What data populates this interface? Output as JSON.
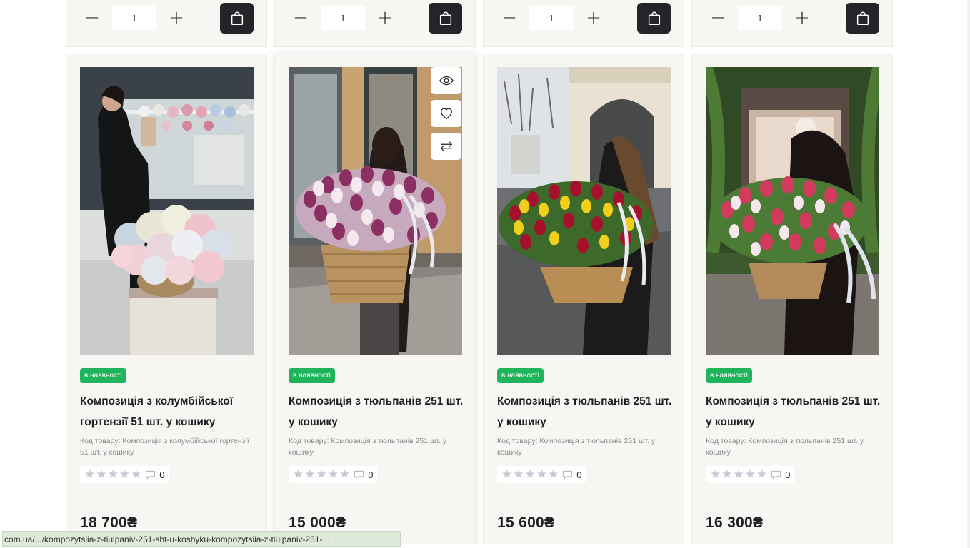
{
  "top_row": {
    "quantity": "1",
    "minus_label": "−",
    "plus_label": "+"
  },
  "products": [
    {
      "badge": "в наявності",
      "title": "Композиція з колумбійської гортензії 51 шт. у кошику",
      "sku": "Код товару: Композиція з колумбійської гортензії 51 шт. у кошику",
      "review_count": "0",
      "price": "18 700₴"
    },
    {
      "badge": "в наявності",
      "title": "Композиція з тюльпанів 251 шт. у кошику",
      "sku": "Код товару: Композиція з тюльпанів 251 шт. у кошику",
      "review_count": "0",
      "price": "15 000₴"
    },
    {
      "badge": "в наявності",
      "title": "Композиція з тюльпанів 251 шт. у кошику",
      "sku": "Код товару: Композиція з тюльпанів 251 шт. у кошику",
      "review_count": "0",
      "price": "15 600₴"
    },
    {
      "badge": "в наявності",
      "title": "Композиція з тюльпанів 251 шт. у кошику",
      "sku": "Код товару: Композиція з тюльпанів 251 шт. у кошику",
      "review_count": "0",
      "price": "16 300₴"
    }
  ],
  "status_url": "com.ua/.../kompozytsiia-z-tiulpaniv-251-sht-u-koshyku-kompozytsiia-z-tiulpaniv-251-...",
  "icons": {
    "cart": "shopping-bag-icon",
    "view": "eye-icon",
    "wishlist": "heart-icon",
    "compare": "compare-arrows-icon",
    "star": "star-icon",
    "comment": "comment-icon"
  }
}
